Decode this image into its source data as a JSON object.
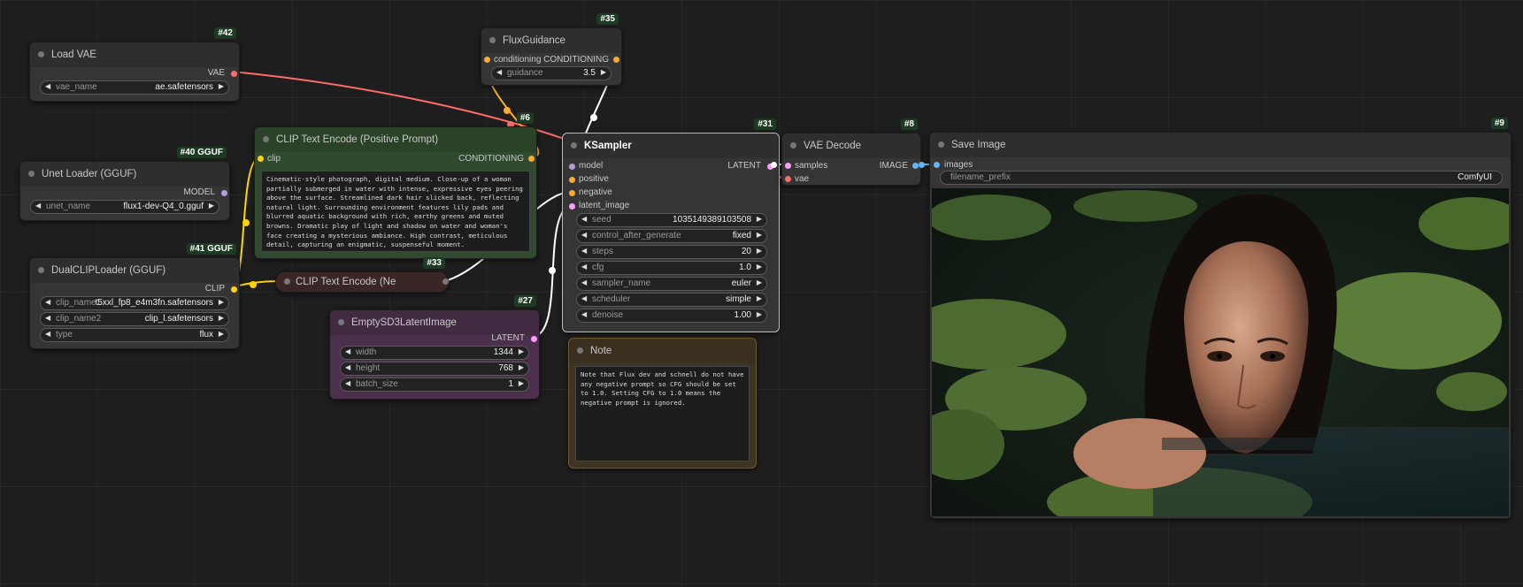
{
  "colors": {
    "canvas": "#1e1e1e",
    "node_bg": "#353535",
    "node_title": "#2e2e2e",
    "positive_node": "#2f4a2e",
    "negative_node": "#3a2626",
    "latent_node": "#4b2f4b",
    "note_node": "#3f3322",
    "vae_wire": "#ff6b6b",
    "clip_wire": "#ffd500",
    "conditioning_wire": "#ffa931",
    "latent_wire": "#ff9cf9",
    "image_wire": "#64b5f6",
    "model_wire": "#b39ddb"
  },
  "nodes": {
    "load_vae": {
      "badge": "#42",
      "title": "Load VAE",
      "out_vae": "VAE",
      "w_vae_name_label": "vae_name",
      "w_vae_name_value": "ae.safetensors"
    },
    "unet_loader": {
      "badge": "#40 GGUF",
      "title": "Unet Loader (GGUF)",
      "out_model": "MODEL",
      "w_unet_name_label": "unet_name",
      "w_unet_name_value": "flux1-dev-Q4_0.gguf"
    },
    "dual_clip": {
      "badge": "#41 GGUF",
      "title": "DualCLIPLoader (GGUF)",
      "out_clip": "CLIP",
      "w_clip1_label": "clip_name1",
      "w_clip1_value": "t5xxl_fp8_e4m3fn.safetensors",
      "w_clip2_label": "clip_name2",
      "w_clip2_value": "clip_l.safetensors",
      "w_type_label": "type",
      "w_type_value": "flux"
    },
    "flux_guidance": {
      "badge": "#35",
      "title": "FluxGuidance",
      "in_conditioning": "conditioning",
      "out_conditioning": "CONDITIONING",
      "w_guidance_label": "guidance",
      "w_guidance_value": "3.5"
    },
    "clip_positive": {
      "badge": "#6",
      "title": "CLIP Text Encode (Positive Prompt)",
      "in_clip": "clip",
      "out_conditioning": "CONDITIONING",
      "text": "Cinematic-style photograph, digital medium. Close-up of a woman partially submerged in water with intense, expressive eyes peering above the surface. Streamlined dark hair slicked back, reflecting natural light. Surrounding environment features lily pads and blurred aquatic background with rich, earthy greens and muted browns. Dramatic play of light and shadow on water and woman's face creating a mysterious ambiance. High contrast, meticulous detail, capturing an enigmatic, suspenseful moment."
    },
    "clip_negative": {
      "badge": "#33",
      "title": "CLIP Text Encode (Ne"
    },
    "empty_latent": {
      "badge": "#27",
      "title": "EmptySD3LatentImage",
      "out_latent": "LATENT",
      "w_width_label": "width",
      "w_width_value": "1344",
      "w_height_label": "height",
      "w_height_value": "768",
      "w_batch_label": "batch_size",
      "w_batch_value": "1"
    },
    "ksampler": {
      "badge": "#31",
      "title": "KSampler",
      "in_model": "model",
      "in_positive": "positive",
      "in_negative": "negative",
      "in_latent": "latent_image",
      "out_latent": "LATENT",
      "widgets": [
        {
          "label": "seed",
          "value": "1035149389103508"
        },
        {
          "label": "control_after_generate",
          "value": "fixed"
        },
        {
          "label": "steps",
          "value": "20"
        },
        {
          "label": "cfg",
          "value": "1.0"
        },
        {
          "label": "sampler_name",
          "value": "euler"
        },
        {
          "label": "scheduler",
          "value": "simple"
        },
        {
          "label": "denoise",
          "value": "1.00"
        }
      ]
    },
    "vae_decode": {
      "badge": "#8",
      "title": "VAE Decode",
      "in_samples": "samples",
      "in_vae": "vae",
      "out_image": "IMAGE"
    },
    "save_image": {
      "badge": "#9",
      "title": "Save Image",
      "in_images": "images",
      "w_prefix_label": "filename_prefix",
      "w_prefix_value": "ComfyUI"
    },
    "note": {
      "title": "Note",
      "text": "Note that Flux dev and schnell do not have any negative prompt so CFG should be set to 1.0. Setting CFG to 1.0 means the negative prompt is ignored."
    }
  }
}
